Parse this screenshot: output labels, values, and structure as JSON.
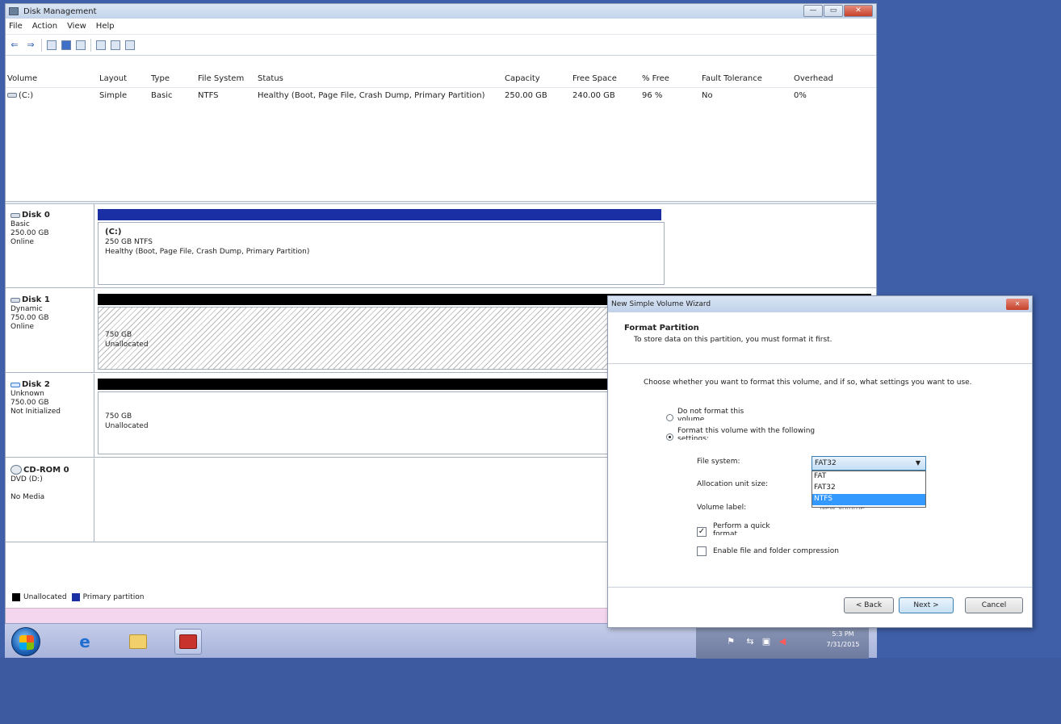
{
  "window": {
    "title": "Disk Management",
    "controls": {
      "minimize": "—",
      "maximize": "▭",
      "close": "✕"
    }
  },
  "menu": [
    "File",
    "Action",
    "View",
    "Help"
  ],
  "volume_table": {
    "columns": [
      "Volume",
      "Layout",
      "Type",
      "File System",
      "Status",
      "Capacity",
      "Free Space",
      "% Free",
      "Fault Tolerance",
      "Overhead"
    ],
    "rows": [
      [
        "(C:)",
        "Simple",
        "Basic",
        "NTFS",
        "Healthy (Boot, Page File, Crash Dump, Primary Partition)",
        "250.00 GB",
        "240.00 GB",
        "96 %",
        "No",
        "0%"
      ]
    ]
  },
  "disks": [
    {
      "name": "Disk 0",
      "lines": [
        "Basic",
        "250.00 GB",
        "Online"
      ],
      "partition": {
        "title": "(C:)",
        "lines": [
          "250 GB NTFS",
          "Healthy (Boot, Page File, Crash Dump, Primary Partition)"
        ]
      }
    },
    {
      "name": "Disk 1",
      "lines": [
        "Dynamic",
        "750.00 GB",
        "Online"
      ],
      "partition": {
        "lines": [
          "750 GB",
          "Unallocated"
        ]
      }
    },
    {
      "name": "Disk 2",
      "lines": [
        "Unknown",
        "750.00 GB",
        "Not Initialized"
      ],
      "partition": {
        "lines": [
          "750 GB",
          "Unallocated"
        ]
      }
    },
    {
      "name": "CD-ROM 0",
      "lines": [
        "DVD (D:)",
        "",
        "No Media"
      ]
    }
  ],
  "legend": [
    {
      "label": "Unallocated",
      "color": "#000000"
    },
    {
      "label": "Primary partition",
      "color": "#1a2fa3"
    }
  ],
  "dialog": {
    "title": "New Simple Volume Wizard",
    "heading": "Format Partition",
    "subheading": "To store data on this partition, you must format it first.",
    "instruction": "Choose whether you want to format this volume, and if so, what settings you want to use.",
    "option_no_format": [
      "Do not format this",
      "volume"
    ],
    "option_format": [
      "Format this volume with the following",
      "settings:"
    ],
    "fields": {
      "file_system_label": "File system:",
      "allocation_label": "Allocation unit size:",
      "volume_label_label": "Volume label:"
    },
    "file_system_value": "FAT32",
    "file_system_options": [
      "FAT",
      "FAT32",
      "NTFS"
    ],
    "volume_label_hint": "New Volume",
    "quick_format": [
      "Perform a quick",
      "format"
    ],
    "compression": "Enable file and folder compression",
    "buttons": {
      "back": "< Back",
      "next": "Next >",
      "cancel": "Cancel"
    }
  },
  "taskbar": {
    "clock_time": "5:3 PM",
    "clock_date": "7/31/2015"
  },
  "colors": {
    "primary_partition": "#1a2fa3",
    "unallocated": "#000000",
    "desktop": "#3f5fa8",
    "dropdown_selected": "#3399ff"
  }
}
